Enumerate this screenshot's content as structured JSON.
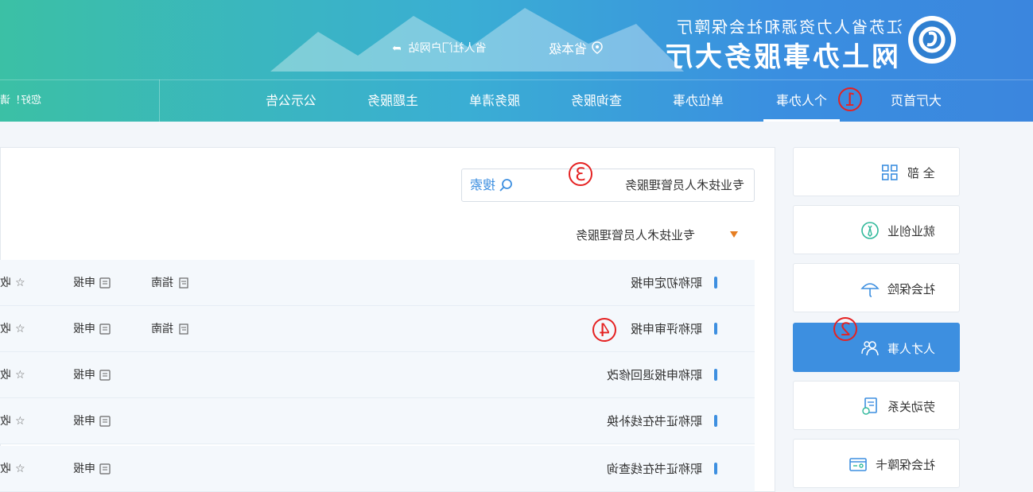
{
  "header": {
    "org_title": "江苏省人力资源和社会保障厅",
    "hall_title": "网上办事服务大厅",
    "region": "省本级",
    "portal_link": "省人社门户网站",
    "greeting": "您好！请"
  },
  "nav": {
    "items": [
      {
        "label": "大厅首页"
      },
      {
        "label": "个人办事"
      },
      {
        "label": "单位办事"
      },
      {
        "label": "查询服务"
      },
      {
        "label": "服务清单"
      },
      {
        "label": "主题服务"
      },
      {
        "label": "公示公告"
      }
    ],
    "active_index": 1
  },
  "annotations": [
    "1",
    "2",
    "3",
    "4"
  ],
  "sidebar": {
    "items": [
      {
        "label": "全 部",
        "icon": "grid-icon"
      },
      {
        "label": "就业创业",
        "icon": "employment-icon"
      },
      {
        "label": "社会保险",
        "icon": "umbrella-icon"
      },
      {
        "label": "人才人事",
        "icon": "people-icon"
      },
      {
        "label": "劳动关系",
        "icon": "contract-icon"
      },
      {
        "label": "社会保障卡",
        "icon": "card-icon"
      }
    ],
    "active_index": 3
  },
  "search": {
    "value": "专业技术人员管理服务",
    "button_label": "搜索"
  },
  "section": {
    "title": "专业技术人员管理服务"
  },
  "services": [
    {
      "name": "职称初定申报",
      "guide": "指南",
      "apply": "申报",
      "favorite": "收藏"
    },
    {
      "name": "职称评审申报",
      "guide": "指南",
      "apply": "申报",
      "favorite": "收藏"
    },
    {
      "name": "职称申报退回修改",
      "guide": "",
      "apply": "申报",
      "favorite": "收藏"
    },
    {
      "name": "职称证书在线补换",
      "guide": "",
      "apply": "申报",
      "favorite": "收藏"
    },
    {
      "name": "职称证书在线查询",
      "guide": "",
      "apply": "申报",
      "favorite": "收藏"
    }
  ],
  "colors": {
    "accent": "#3d8fe0",
    "annotation": "#e52222",
    "triangle": "#e67e22"
  }
}
